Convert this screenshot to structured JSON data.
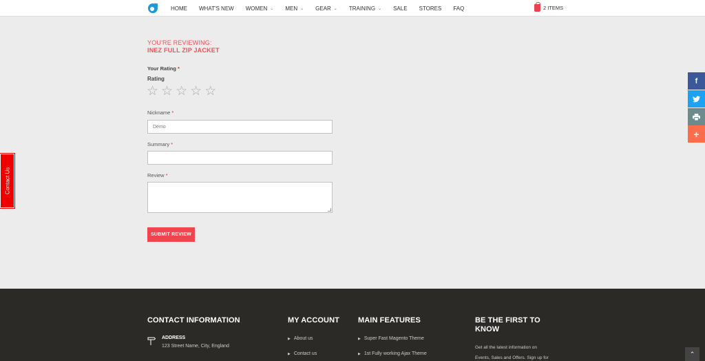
{
  "header": {
    "nav": [
      {
        "label": "HOME",
        "dropdown": false
      },
      {
        "label": "WHAT'S NEW",
        "dropdown": false
      },
      {
        "label": "WOMEN",
        "dropdown": true
      },
      {
        "label": "MEN",
        "dropdown": true
      },
      {
        "label": "GEAR",
        "dropdown": true
      },
      {
        "label": "TRAINING",
        "dropdown": true
      },
      {
        "label": "SALE",
        "dropdown": false
      },
      {
        "label": "STORES",
        "dropdown": false
      },
      {
        "label": "FAQ",
        "dropdown": false
      }
    ],
    "cart_label": "2 ITEMS"
  },
  "review": {
    "reviewing_label": "YOU'RE REVIEWING:",
    "product_name": "INEZ FULL ZIP JACKET",
    "your_rating_label": "Your Rating",
    "required_mark": "*",
    "rating_title": "Rating",
    "star_count": 5,
    "nickname_label": "Nickname",
    "nickname_value": "Demo",
    "summary_label": "Summary",
    "summary_value": "",
    "review_label": "Review",
    "review_value": "",
    "submit_label": "SUBMIT REVIEW"
  },
  "contact_tab_label": "Contact Us",
  "social": [
    "facebook-icon",
    "twitter-icon",
    "print-icon",
    "plus-icon"
  ],
  "footer": {
    "contact_heading": "CONTACT INFORMATION",
    "address_title": "ADDRESS",
    "address_text": "123 Street Name, City, England",
    "account_heading": "MY ACCOUNT",
    "account_links": [
      "About us",
      "Contact us"
    ],
    "features_heading": "MAIN FEATURES",
    "features_links": [
      "Super Fast Magento Theme",
      "1st Fully working Ajax Theme"
    ],
    "newsletter_heading_line1": "BE THE FIRST TO",
    "newsletter_heading_line2": "KNOW",
    "newsletter_text_line1": "Get all the latest information on",
    "newsletter_text_line2": "Events, Sales and Offers. Sign up for"
  },
  "colors": {
    "accent": "#f0454f",
    "footer_bg": "#2b2a27",
    "page_bg": "#ececec"
  }
}
